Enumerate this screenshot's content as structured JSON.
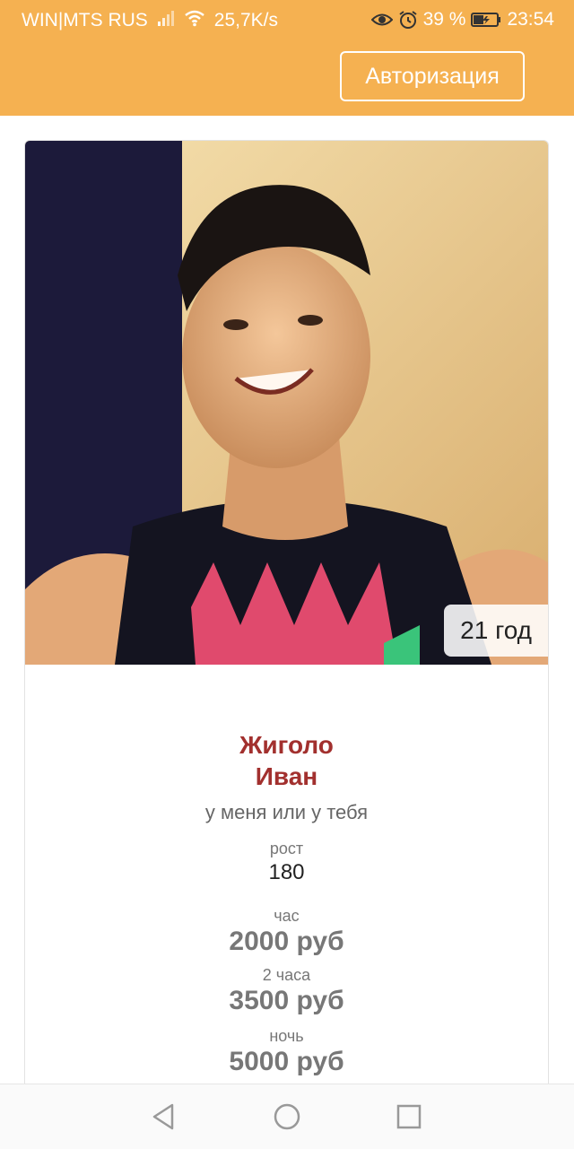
{
  "status_bar": {
    "carrier": "WIN|MTS RUS",
    "speed": "25,7K/s",
    "battery": "39 %",
    "time": "23:54",
    "icons": [
      "signal-icon",
      "wifi-icon",
      "eye-icon",
      "alarm-icon",
      "battery-icon"
    ]
  },
  "header": {
    "auth_label": "Авторизация",
    "background": "#f5b151"
  },
  "profile": {
    "age": "21 год",
    "name_line1": "Жиголо",
    "name_line2": "Иван",
    "location": "у меня или у тебя",
    "height_label": "рост",
    "height_value": "180",
    "rates": [
      {
        "label": "час",
        "price": "2000 руб"
      },
      {
        "label": "2 часа",
        "price": "3500 руб"
      },
      {
        "label": "ночь",
        "price": "5000 руб"
      }
    ],
    "accent": "#a2302e"
  },
  "nav": {
    "icons": [
      "back-icon",
      "home-icon",
      "recents-icon"
    ]
  }
}
